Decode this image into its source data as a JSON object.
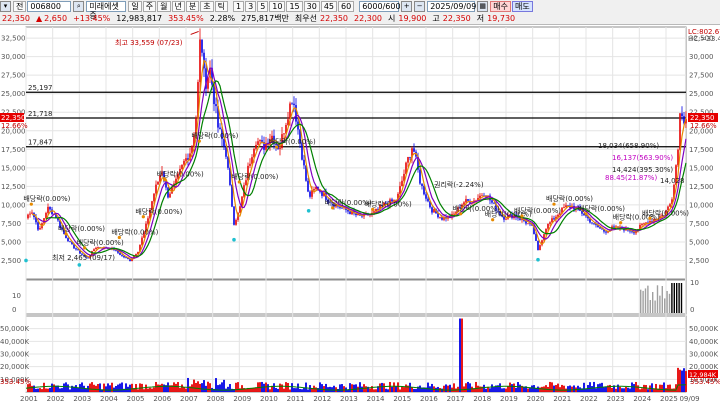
{
  "toolbar": {
    "period_buttons": [
      "일",
      "주",
      "월",
      "년",
      "분",
      "초",
      "틱"
    ],
    "interval_buttons": [
      "1",
      "3",
      "5",
      "10",
      "15",
      "30",
      "45",
      "60"
    ],
    "market_label": "전",
    "code": "006800",
    "name": "미래에셋증",
    "count": "6000/6000",
    "date": "2025/09/09",
    "buy_label": "매수",
    "sell_label": "매도"
  },
  "quote": {
    "price": "22,350",
    "change": "2,650",
    "change_pct": "+13.45%",
    "volume": "12,983,817",
    "volume_pct": "353.45%",
    "turnover_pct": "2.28%",
    "amount": "275,817백만",
    "priority_label": "최우선",
    "priority_ask": "22,350",
    "priority_bid": "22,300",
    "open_label": "시",
    "open": "19,900",
    "high_label": "고",
    "high": "22,350",
    "low_label": "저",
    "low": "19,730"
  },
  "price_axis": {
    "ticks": [
      "32,500",
      "30,000",
      "27,500",
      "25,000",
      "22,500",
      "20,000",
      "17,500",
      "15,000",
      "12,500",
      "10,000",
      "7,500",
      "5,000",
      "2,500"
    ],
    "current_price": "22,350",
    "current_pct": "12.66%",
    "lc_label": "LC:802.67",
    "hc_label": "HC:=33.40"
  },
  "horizontal_lines": [
    "25,197",
    "21,718",
    "17,847"
  ],
  "annotations": {
    "high": "최고 33,559 (07/23)",
    "low": "최저 2,465 (09/17)",
    "right_block_1": "18,034(658.90%)",
    "right_block_2": "16,137(563.90%)",
    "right_block_3": "14,424(395.30%)",
    "right_block_4": "88.45(21.87%)",
    "right_block_5": "14,028",
    "right_price_1": "22,350",
    "right_price_2": "12.66%",
    "dividend": "배당락(0.00%)",
    "rights": "권리락(-2.24%)"
  },
  "indicator_axis": {
    "ticks": [
      "10",
      "0"
    ]
  },
  "volume_axis": {
    "ticks": [
      "50,000K",
      "40,000K",
      "30,000K",
      "20,000K",
      "10,000K"
    ],
    "current": "12,984K",
    "current_pct": "353.45%"
  },
  "time_axis": [
    "2001",
    "2002",
    "2003",
    "2004",
    "2005",
    "2006",
    "2007",
    "2008",
    "2009",
    "2010",
    "2011",
    "2012",
    "2013",
    "2014",
    "2015",
    "2016",
    "2017",
    "2018",
    "2019",
    "2020",
    "2021",
    "2022",
    "2023",
    "2024",
    "2025",
    "09/09"
  ],
  "colors": {
    "up": "#e60000",
    "down": "#0000e6",
    "ma_short": "#e68a00",
    "ma_mid": "#8000c0",
    "ma_long": "#008000"
  },
  "chart_data": {
    "type": "line",
    "title": "",
    "x_unit": "year",
    "ylim": [
      0,
      34000
    ],
    "series": [
      {
        "name": "",
        "points": [
          [
            2001.0,
            8200
          ],
          [
            2001.2,
            9400
          ],
          [
            2001.5,
            6400
          ],
          [
            2001.8,
            9600
          ],
          [
            2002.1,
            8600
          ],
          [
            2002.4,
            6200
          ],
          [
            2002.7,
            4600
          ],
          [
            2003.0,
            3600
          ],
          [
            2003.3,
            2700
          ],
          [
            2003.6,
            4300
          ],
          [
            2004.0,
            4200
          ],
          [
            2004.3,
            4000
          ],
          [
            2004.6,
            3100
          ],
          [
            2004.9,
            2500
          ],
          [
            2005.2,
            3800
          ],
          [
            2005.5,
            7200
          ],
          [
            2005.8,
            11600
          ],
          [
            2006.1,
            14800
          ],
          [
            2006.3,
            11200
          ],
          [
            2006.6,
            12800
          ],
          [
            2006.9,
            15600
          ],
          [
            2007.2,
            17500
          ],
          [
            2007.4,
            22500
          ],
          [
            2007.55,
            33559
          ],
          [
            2007.7,
            26200
          ],
          [
            2007.9,
            28300
          ],
          [
            2008.2,
            20500
          ],
          [
            2008.5,
            17000
          ],
          [
            2008.8,
            7600
          ],
          [
            2009.0,
            9200
          ],
          [
            2009.3,
            14500
          ],
          [
            2009.6,
            18900
          ],
          [
            2009.9,
            17800
          ],
          [
            2010.2,
            19500
          ],
          [
            2010.5,
            17600
          ],
          [
            2010.8,
            22100
          ],
          [
            2011.0,
            24800
          ],
          [
            2011.3,
            17900
          ],
          [
            2011.6,
            11000
          ],
          [
            2011.9,
            12400
          ],
          [
            2012.2,
            11200
          ],
          [
            2012.6,
            10000
          ],
          [
            2013.0,
            9300
          ],
          [
            2013.5,
            8400
          ],
          [
            2014.0,
            8800
          ],
          [
            2014.5,
            10200
          ],
          [
            2014.9,
            10600
          ],
          [
            2015.3,
            15900
          ],
          [
            2015.5,
            18100
          ],
          [
            2015.8,
            12800
          ],
          [
            2016.2,
            9400
          ],
          [
            2016.6,
            8200
          ],
          [
            2017.0,
            8500
          ],
          [
            2017.4,
            10400
          ],
          [
            2017.8,
            10600
          ],
          [
            2018.2,
            11700
          ],
          [
            2018.6,
            9600
          ],
          [
            2018.9,
            8300
          ],
          [
            2019.3,
            8600
          ],
          [
            2019.7,
            7800
          ],
          [
            2020.0,
            6900
          ],
          [
            2020.2,
            3800
          ],
          [
            2020.5,
            7000
          ],
          [
            2020.9,
            8600
          ],
          [
            2021.2,
            9700
          ],
          [
            2021.5,
            9800
          ],
          [
            2021.9,
            8800
          ],
          [
            2022.3,
            7300
          ],
          [
            2022.7,
            6400
          ],
          [
            2023.0,
            6900
          ],
          [
            2023.4,
            6800
          ],
          [
            2023.8,
            6400
          ],
          [
            2024.2,
            7500
          ],
          [
            2024.6,
            8200
          ],
          [
            2024.9,
            8600
          ],
          [
            2025.2,
            10400
          ],
          [
            2025.45,
            17500
          ],
          [
            2025.55,
            25200
          ],
          [
            2025.63,
            19700
          ],
          [
            2025.69,
            22350
          ]
        ]
      }
    ]
  }
}
